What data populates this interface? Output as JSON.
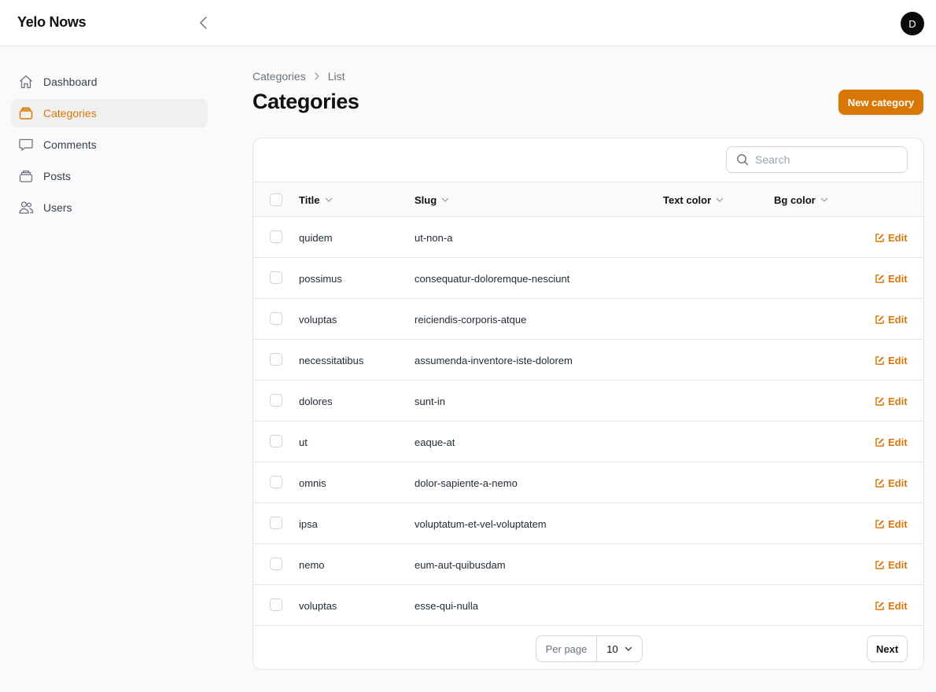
{
  "app": {
    "brand": "Yelo Nows",
    "avatar_initial": "D",
    "accent": "#d97706"
  },
  "sidebar": {
    "items": [
      {
        "label": "Dashboard",
        "icon": "home-icon",
        "active": false
      },
      {
        "label": "Categories",
        "icon": "category-icon",
        "active": true
      },
      {
        "label": "Comments",
        "icon": "chat-bubble-icon",
        "active": false
      },
      {
        "label": "Posts",
        "icon": "stack-icon",
        "active": false
      },
      {
        "label": "Users",
        "icon": "users-icon",
        "active": false
      }
    ]
  },
  "breadcrumb": {
    "parent": "Categories",
    "current": "List"
  },
  "page": {
    "title": "Categories",
    "new_button": "New category"
  },
  "search": {
    "placeholder": "Search",
    "value": ""
  },
  "table": {
    "columns": {
      "title": "Title",
      "slug": "Slug",
      "text_color": "Text color",
      "bg_color": "Bg color"
    },
    "edit_label": "Edit",
    "rows": [
      {
        "title": "quidem",
        "slug": "ut-non-a"
      },
      {
        "title": "possimus",
        "slug": "consequatur-doloremque-nesciunt"
      },
      {
        "title": "voluptas",
        "slug": "reiciendis-corporis-atque"
      },
      {
        "title": "necessitatibus",
        "slug": "assumenda-inventore-iste-dolorem"
      },
      {
        "title": "dolores",
        "slug": "sunt-in"
      },
      {
        "title": "ut",
        "slug": "eaque-at"
      },
      {
        "title": "omnis",
        "slug": "dolor-sapiente-a-nemo"
      },
      {
        "title": "ipsa",
        "slug": "voluptatum-et-vel-voluptatem"
      },
      {
        "title": "nemo",
        "slug": "eum-aut-quibusdam"
      },
      {
        "title": "voluptas",
        "slug": "esse-qui-nulla"
      }
    ]
  },
  "pagination": {
    "per_page_label": "Per page",
    "per_page_value": "10",
    "next_label": "Next"
  }
}
